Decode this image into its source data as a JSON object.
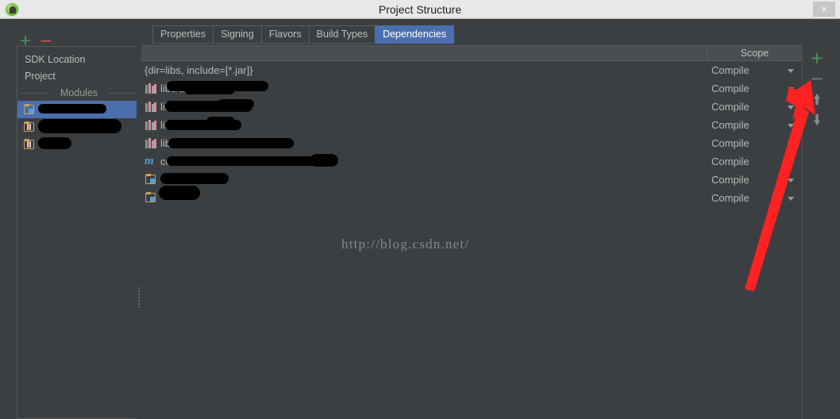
{
  "window": {
    "title": "Project Structure",
    "app_icon": "android-studio-icon",
    "close_label": "×"
  },
  "sidebar": {
    "toolbar": {
      "add_label": "+",
      "remove_label": "−"
    },
    "items": [
      {
        "label": "SDK Location",
        "type": "link"
      },
      {
        "label": "Project",
        "type": "link"
      }
    ],
    "group_label": "Modules",
    "modules": [
      {
        "label": "",
        "redacted": true,
        "selected": true,
        "icon": "module-folder-icon"
      },
      {
        "label": "",
        "redacted": true,
        "selected": false,
        "icon": "module-folder-icon"
      },
      {
        "label": "",
        "redacted": true,
        "selected": false,
        "icon": "module-folder-icon"
      }
    ]
  },
  "tabs": [
    {
      "label": "Properties",
      "active": false
    },
    {
      "label": "Signing",
      "active": false
    },
    {
      "label": "Flavors",
      "active": false
    },
    {
      "label": "Build Types",
      "active": false
    },
    {
      "label": "Dependencies",
      "active": true
    }
  ],
  "table": {
    "headers": {
      "name": "",
      "scope": "Scope"
    },
    "rows": [
      {
        "icon": "none",
        "label": "{dir=libs, include=[*.jar]}",
        "redacted": false,
        "scope": "Compile"
      },
      {
        "icon": "jar-library-icon",
        "label": "libs/a",
        "redacted": true,
        "scope": "Compile"
      },
      {
        "icon": "jar-library-icon",
        "label": "lib",
        "redacted": true,
        "scope": "Compile"
      },
      {
        "icon": "jar-library-icon",
        "label": "lib",
        "redacted": true,
        "scope": "Compile"
      },
      {
        "icon": "jar-library-icon",
        "label": "libs/",
        "redacted": true,
        "scope": "Compile"
      },
      {
        "icon": "maven-icon",
        "label": "co",
        "redacted": true,
        "scope": "Compile"
      },
      {
        "icon": "module-folder-icon",
        "label": "",
        "redacted": true,
        "scope": "Compile"
      },
      {
        "icon": "module-folder-icon",
        "label": "",
        "redacted": true,
        "scope": "Compile"
      }
    ]
  },
  "edge_toolbar": {
    "add_label": "+",
    "remove_label": "−",
    "move_up": "move-up-arrow",
    "move_down": "move-down-arrow"
  },
  "annotation": {
    "arrow_color": "#ff2222",
    "points_to": "add-dependency-button"
  },
  "watermark": {
    "text": "http://blog.csdn.net/"
  },
  "colors": {
    "accent_selection": "#4b6eaf",
    "panel_bg": "#3c3f41",
    "titlebar_bg": "#e8e8e8",
    "add_green": "#499c54",
    "remove_red": "#c75450"
  }
}
